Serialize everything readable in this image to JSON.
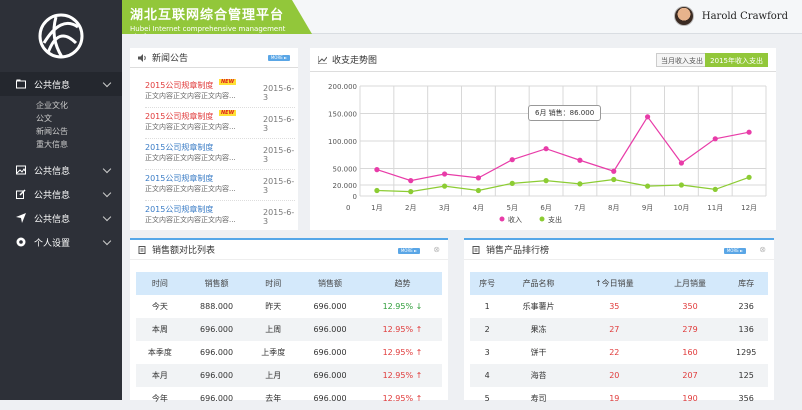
{
  "header": {
    "title_cn": "湖北互联网综合管理平台",
    "title_en": "Hubei Internet comprehensive management platform",
    "user_name": "Harold Crawford"
  },
  "sidebar": {
    "items": [
      {
        "label": "公共信息",
        "icon": "folder-icon"
      },
      {
        "label": "公共信息",
        "icon": "image-icon"
      },
      {
        "label": "公共信息",
        "icon": "edit-icon"
      },
      {
        "label": "公共信息",
        "icon": "send-icon"
      },
      {
        "label": "个人设置",
        "icon": "gear-icon"
      }
    ],
    "subitems": [
      "企业文化",
      "公文",
      "新闻公告",
      "重大信息"
    ]
  },
  "news": {
    "title": "新闻公告",
    "more": "MORE ►",
    "rows": [
      {
        "title": "2015公司规章制度",
        "new": "NEW",
        "summary": "正文内容正文内容正文内容...",
        "date": "2015-6-3"
      },
      {
        "title": "2015公司规章制度",
        "new": "NEW",
        "summary": "正文内容正文内容正文内容...",
        "date": "2015-6-3"
      },
      {
        "title": "2015公司规章制度",
        "new": "",
        "summary": "正文内容正文内容正文内容...",
        "date": "2015-6-3"
      },
      {
        "title": "2015公司规章制度",
        "new": "",
        "summary": "正文内容正文内容正文内容...",
        "date": "2015-6-3"
      },
      {
        "title": "2015公司规章制度",
        "new": "",
        "summary": "正文内容正文内容正文内容...",
        "date": "2015-6-3"
      }
    ]
  },
  "chart_panel": {
    "title": "收支走势图",
    "tab_month": "当月收入支出",
    "tab_year": "2015年收入支出",
    "tooltip": "6月 销售：86.000"
  },
  "chart_data": {
    "type": "line",
    "categories": [
      "1月",
      "2月",
      "3月",
      "4月",
      "5月",
      "6月",
      "7月",
      "8月",
      "9月",
      "10月",
      "11月",
      "12月"
    ],
    "yticks": [
      "200.000",
      "150.000",
      "100.000",
      "50.000",
      "20.000",
      "0"
    ],
    "ylim": [
      0,
      200
    ],
    "series": [
      {
        "name": "收入",
        "color": "#e83ca8",
        "values": [
          48,
          28,
          40,
          33,
          66,
          86,
          65,
          45,
          144,
          60,
          104,
          116
        ]
      },
      {
        "name": "支出",
        "color": "#8ccc33",
        "values": [
          10,
          8,
          18,
          10,
          23,
          28,
          22,
          30,
          18,
          20,
          12,
          34
        ]
      }
    ]
  },
  "sales_compare": {
    "title": "销售额对比列表",
    "more": "MORE ►",
    "close": "⊗",
    "headers": [
      "时间",
      "销售额",
      "时间",
      "销售额",
      "趋势"
    ],
    "rows": [
      {
        "t1": "今天",
        "v1": "888.000",
        "t2": "昨天",
        "v2": "696.000",
        "trend": "12.95%",
        "dir": "down"
      },
      {
        "t1": "本周",
        "v1": "696.000",
        "t2": "上周",
        "v2": "696.000",
        "trend": "12.95%",
        "dir": "up"
      },
      {
        "t1": "本季度",
        "v1": "696.000",
        "t2": "上季度",
        "v2": "696.000",
        "trend": "12.95%",
        "dir": "up"
      },
      {
        "t1": "本月",
        "v1": "696.000",
        "t2": "上月",
        "v2": "696.000",
        "trend": "12.95%",
        "dir": "up"
      },
      {
        "t1": "今年",
        "v1": "696.000",
        "t2": "去年",
        "v2": "696.000",
        "trend": "12.95%",
        "dir": "up"
      }
    ]
  },
  "product_rank": {
    "title": "销售产品排行榜",
    "more": "MORE ►",
    "close": "⊗",
    "headers": [
      "序号",
      "产品名称",
      "今日销量",
      "上月销量",
      "库存"
    ],
    "rows": [
      {
        "no": "1",
        "name": "乐事薯片",
        "today": "35",
        "last": "350",
        "stock": "236"
      },
      {
        "no": "2",
        "name": "果冻",
        "today": "27",
        "last": "279",
        "stock": "136"
      },
      {
        "no": "3",
        "name": "饼干",
        "today": "22",
        "last": "160",
        "stock": "1295"
      },
      {
        "no": "4",
        "name": "海苔",
        "today": "20",
        "last": "207",
        "stock": "125"
      },
      {
        "no": "5",
        "name": "寿司",
        "today": "19",
        "last": "190",
        "stock": "356"
      }
    ]
  }
}
